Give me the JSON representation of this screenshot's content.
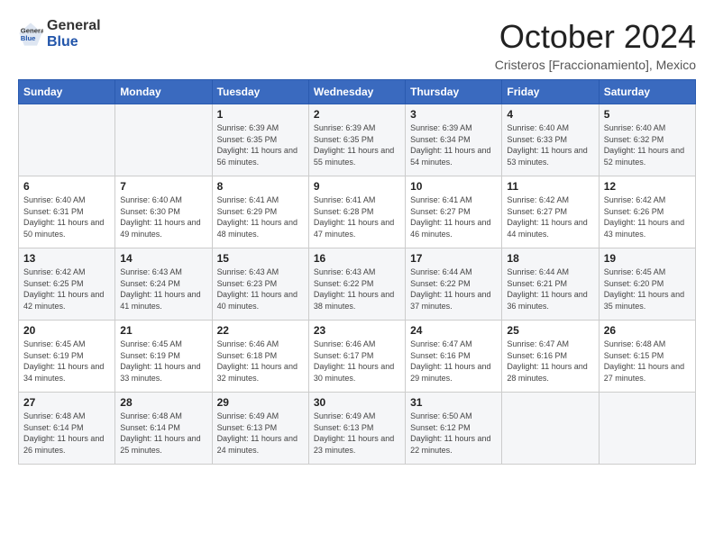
{
  "header": {
    "logo_line1": "General",
    "logo_line2": "Blue",
    "month_title": "October 2024",
    "location": "Cristeros [Fraccionamiento], Mexico"
  },
  "weekdays": [
    "Sunday",
    "Monday",
    "Tuesday",
    "Wednesday",
    "Thursday",
    "Friday",
    "Saturday"
  ],
  "weeks": [
    [
      {
        "day": "",
        "sunrise": "",
        "sunset": "",
        "daylight": ""
      },
      {
        "day": "",
        "sunrise": "",
        "sunset": "",
        "daylight": ""
      },
      {
        "day": "1",
        "sunrise": "Sunrise: 6:39 AM",
        "sunset": "Sunset: 6:35 PM",
        "daylight": "Daylight: 11 hours and 56 minutes."
      },
      {
        "day": "2",
        "sunrise": "Sunrise: 6:39 AM",
        "sunset": "Sunset: 6:35 PM",
        "daylight": "Daylight: 11 hours and 55 minutes."
      },
      {
        "day": "3",
        "sunrise": "Sunrise: 6:39 AM",
        "sunset": "Sunset: 6:34 PM",
        "daylight": "Daylight: 11 hours and 54 minutes."
      },
      {
        "day": "4",
        "sunrise": "Sunrise: 6:40 AM",
        "sunset": "Sunset: 6:33 PM",
        "daylight": "Daylight: 11 hours and 53 minutes."
      },
      {
        "day": "5",
        "sunrise": "Sunrise: 6:40 AM",
        "sunset": "Sunset: 6:32 PM",
        "daylight": "Daylight: 11 hours and 52 minutes."
      }
    ],
    [
      {
        "day": "6",
        "sunrise": "Sunrise: 6:40 AM",
        "sunset": "Sunset: 6:31 PM",
        "daylight": "Daylight: 11 hours and 50 minutes."
      },
      {
        "day": "7",
        "sunrise": "Sunrise: 6:40 AM",
        "sunset": "Sunset: 6:30 PM",
        "daylight": "Daylight: 11 hours and 49 minutes."
      },
      {
        "day": "8",
        "sunrise": "Sunrise: 6:41 AM",
        "sunset": "Sunset: 6:29 PM",
        "daylight": "Daylight: 11 hours and 48 minutes."
      },
      {
        "day": "9",
        "sunrise": "Sunrise: 6:41 AM",
        "sunset": "Sunset: 6:28 PM",
        "daylight": "Daylight: 11 hours and 47 minutes."
      },
      {
        "day": "10",
        "sunrise": "Sunrise: 6:41 AM",
        "sunset": "Sunset: 6:27 PM",
        "daylight": "Daylight: 11 hours and 46 minutes."
      },
      {
        "day": "11",
        "sunrise": "Sunrise: 6:42 AM",
        "sunset": "Sunset: 6:27 PM",
        "daylight": "Daylight: 11 hours and 44 minutes."
      },
      {
        "day": "12",
        "sunrise": "Sunrise: 6:42 AM",
        "sunset": "Sunset: 6:26 PM",
        "daylight": "Daylight: 11 hours and 43 minutes."
      }
    ],
    [
      {
        "day": "13",
        "sunrise": "Sunrise: 6:42 AM",
        "sunset": "Sunset: 6:25 PM",
        "daylight": "Daylight: 11 hours and 42 minutes."
      },
      {
        "day": "14",
        "sunrise": "Sunrise: 6:43 AM",
        "sunset": "Sunset: 6:24 PM",
        "daylight": "Daylight: 11 hours and 41 minutes."
      },
      {
        "day": "15",
        "sunrise": "Sunrise: 6:43 AM",
        "sunset": "Sunset: 6:23 PM",
        "daylight": "Daylight: 11 hours and 40 minutes."
      },
      {
        "day": "16",
        "sunrise": "Sunrise: 6:43 AM",
        "sunset": "Sunset: 6:22 PM",
        "daylight": "Daylight: 11 hours and 38 minutes."
      },
      {
        "day": "17",
        "sunrise": "Sunrise: 6:44 AM",
        "sunset": "Sunset: 6:22 PM",
        "daylight": "Daylight: 11 hours and 37 minutes."
      },
      {
        "day": "18",
        "sunrise": "Sunrise: 6:44 AM",
        "sunset": "Sunset: 6:21 PM",
        "daylight": "Daylight: 11 hours and 36 minutes."
      },
      {
        "day": "19",
        "sunrise": "Sunrise: 6:45 AM",
        "sunset": "Sunset: 6:20 PM",
        "daylight": "Daylight: 11 hours and 35 minutes."
      }
    ],
    [
      {
        "day": "20",
        "sunrise": "Sunrise: 6:45 AM",
        "sunset": "Sunset: 6:19 PM",
        "daylight": "Daylight: 11 hours and 34 minutes."
      },
      {
        "day": "21",
        "sunrise": "Sunrise: 6:45 AM",
        "sunset": "Sunset: 6:19 PM",
        "daylight": "Daylight: 11 hours and 33 minutes."
      },
      {
        "day": "22",
        "sunrise": "Sunrise: 6:46 AM",
        "sunset": "Sunset: 6:18 PM",
        "daylight": "Daylight: 11 hours and 32 minutes."
      },
      {
        "day": "23",
        "sunrise": "Sunrise: 6:46 AM",
        "sunset": "Sunset: 6:17 PM",
        "daylight": "Daylight: 11 hours and 30 minutes."
      },
      {
        "day": "24",
        "sunrise": "Sunrise: 6:47 AM",
        "sunset": "Sunset: 6:16 PM",
        "daylight": "Daylight: 11 hours and 29 minutes."
      },
      {
        "day": "25",
        "sunrise": "Sunrise: 6:47 AM",
        "sunset": "Sunset: 6:16 PM",
        "daylight": "Daylight: 11 hours and 28 minutes."
      },
      {
        "day": "26",
        "sunrise": "Sunrise: 6:48 AM",
        "sunset": "Sunset: 6:15 PM",
        "daylight": "Daylight: 11 hours and 27 minutes."
      }
    ],
    [
      {
        "day": "27",
        "sunrise": "Sunrise: 6:48 AM",
        "sunset": "Sunset: 6:14 PM",
        "daylight": "Daylight: 11 hours and 26 minutes."
      },
      {
        "day": "28",
        "sunrise": "Sunrise: 6:48 AM",
        "sunset": "Sunset: 6:14 PM",
        "daylight": "Daylight: 11 hours and 25 minutes."
      },
      {
        "day": "29",
        "sunrise": "Sunrise: 6:49 AM",
        "sunset": "Sunset: 6:13 PM",
        "daylight": "Daylight: 11 hours and 24 minutes."
      },
      {
        "day": "30",
        "sunrise": "Sunrise: 6:49 AM",
        "sunset": "Sunset: 6:13 PM",
        "daylight": "Daylight: 11 hours and 23 minutes."
      },
      {
        "day": "31",
        "sunrise": "Sunrise: 6:50 AM",
        "sunset": "Sunset: 6:12 PM",
        "daylight": "Daylight: 11 hours and 22 minutes."
      },
      {
        "day": "",
        "sunrise": "",
        "sunset": "",
        "daylight": ""
      },
      {
        "day": "",
        "sunrise": "",
        "sunset": "",
        "daylight": ""
      }
    ]
  ]
}
